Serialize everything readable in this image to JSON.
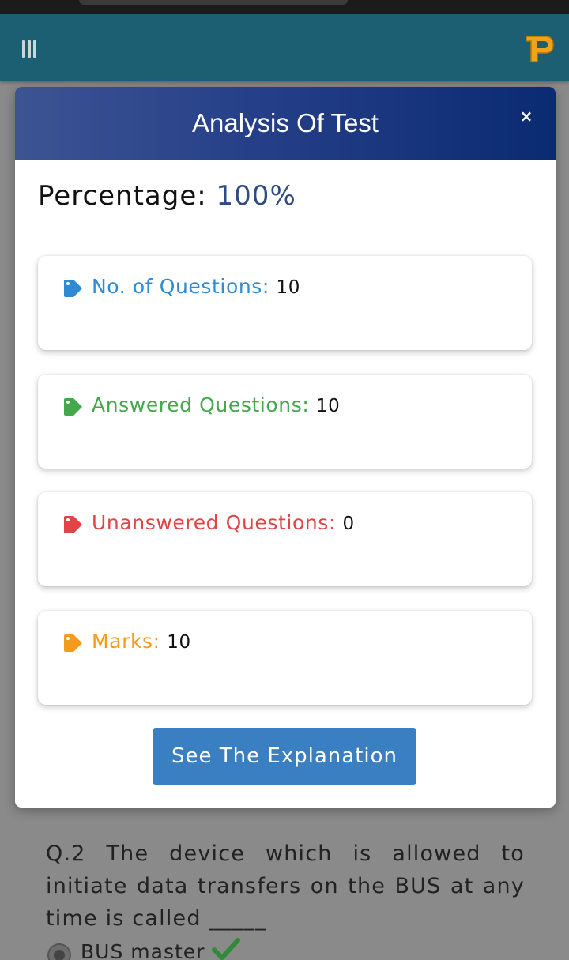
{
  "modal": {
    "title": "Analysis Of Test",
    "close_glyph": "×",
    "percentage_label": "Percentage:",
    "percentage_value": "100%",
    "stats": {
      "total": {
        "label": "No. of Questions:",
        "value": "10",
        "icon": "tag-icon",
        "color": "#2f8ad4"
      },
      "answered": {
        "label": "Answered Questions:",
        "value": "10",
        "icon": "tag-icon",
        "color": "#43a84a"
      },
      "unanswered": {
        "label": "Unanswered Questions:",
        "value": "0",
        "icon": "tag-icon",
        "color": "#e04444"
      },
      "marks": {
        "label": "Marks:",
        "value": "10",
        "icon": "tag-icon",
        "color": "#f39b1c"
      }
    },
    "explain_button": "See The Explanation"
  },
  "appbar": {
    "menu_icon": "menu-icon",
    "logo_icon": "app-logo-p",
    "color": "#1c5f72"
  },
  "background_question": {
    "text": "Q.2 The device which is allowed to initiate data transfers on the BUS at any time is called _____",
    "option_text": "BUS master",
    "option_status_icon": "check-icon"
  }
}
